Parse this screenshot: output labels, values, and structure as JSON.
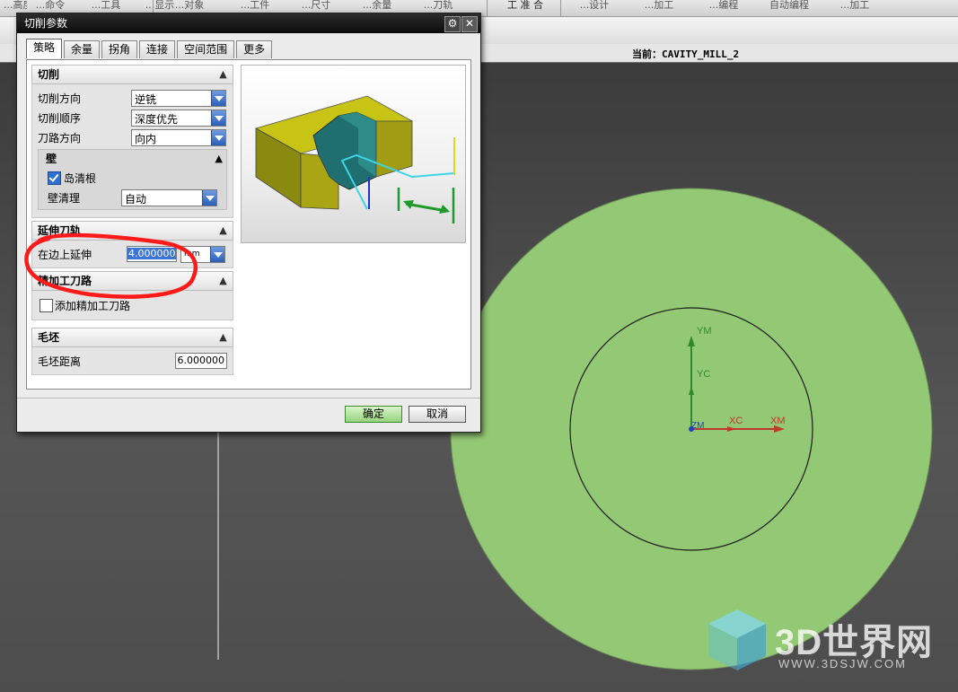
{
  "toolbar": {
    "top_labels": [
      "...高度",
      "...命令",
      "...工具",
      "...显示",
      "...对象",
      "...工件",
      "...尺寸",
      "...余量",
      "...刀轨",
      "工  准  合",
      "...设计",
      "...加工",
      "...编程",
      "自动编程",
      "...加工"
    ],
    "current_label": "当前：",
    "current_op": "CAVITY_MILL_2"
  },
  "dialog": {
    "title": "切削参数",
    "tabs": [
      "策略",
      "余量",
      "拐角",
      "连接",
      "空间范围",
      "更多"
    ],
    "active_tab": "策略",
    "sections": {
      "cutting": {
        "title": "切削",
        "cut_direction": {
          "label": "切削方向",
          "value": "逆铣"
        },
        "cut_order": {
          "label": "切削顺序",
          "value": "深度优先"
        },
        "pattern_direction": {
          "label": "刀路方向",
          "value": "向内"
        },
        "wall": {
          "title": "壁",
          "island_cleanup": {
            "label": "岛清根",
            "checked": true
          },
          "wall_cleanup": {
            "label": "壁清理",
            "value": "自动"
          }
        }
      },
      "extend_path": {
        "title": "延伸刀轨",
        "extend_at_edges": {
          "label": "在边上延伸",
          "value": "4.000000",
          "unit": "mm"
        }
      },
      "finish_passes": {
        "title": "精加工刀路",
        "add_finish_passes": {
          "label": "添加精加工刀路",
          "checked": false
        }
      },
      "blank": {
        "title": "毛坯",
        "blank_distance": {
          "label": "毛坯距离",
          "value": "6.000000"
        }
      }
    },
    "ok_label": "确定",
    "cancel_label": "取消"
  },
  "viewport": {
    "axes": {
      "ym": "YM",
      "yc": "YC",
      "xc": "XC",
      "xm": "XM",
      "zm": "ZM"
    },
    "disk_color": "#93c874",
    "watermark": {
      "text": "3D世界网",
      "url": "WWW.3DSJW.COM"
    }
  }
}
